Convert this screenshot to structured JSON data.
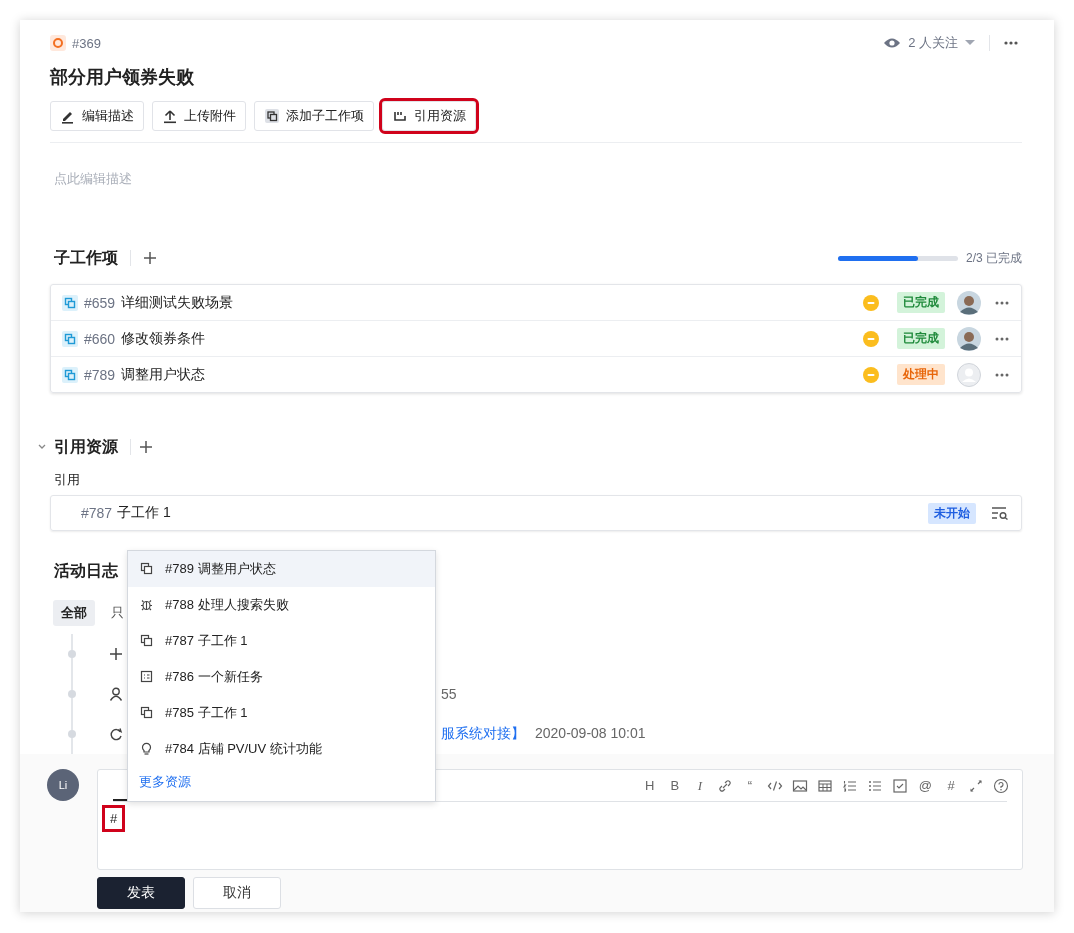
{
  "issue": {
    "kind": "bug",
    "number": "#369",
    "title": "部分用户领券失败"
  },
  "watchers": {
    "label": "2 人关注"
  },
  "actions": [
    {
      "kind": "edit",
      "label": "编辑描述",
      "highlighted": false
    },
    {
      "kind": "upload",
      "label": "上传附件",
      "highlighted": false
    },
    {
      "kind": "subtask",
      "label": "添加子工作项",
      "highlighted": false
    },
    {
      "kind": "quote",
      "label": "引用资源",
      "highlighted": true
    }
  ],
  "description": {
    "placeholder": "点此编辑描述"
  },
  "subtasks": {
    "title": "子工作项",
    "progress": {
      "level": 0.67,
      "label": "2/3 已完成"
    },
    "rows": [
      {
        "number": "#659",
        "title": "详细测试失败场景",
        "status": "已完成",
        "kind": "done",
        "assigned": true
      },
      {
        "number": "#660",
        "title": "修改领券条件",
        "status": "已完成",
        "kind": "done",
        "assigned": true
      },
      {
        "number": "#789",
        "title": "调整用户状态",
        "status": "处理中",
        "kind": "doing",
        "assigned": false
      }
    ]
  },
  "references": {
    "title": "引用资源",
    "expanded": true,
    "label": "引用",
    "items": [
      {
        "number": "#787",
        "title": "子工作 1",
        "status": "未开始",
        "kind": "todo"
      }
    ]
  },
  "activity": {
    "title": "活动日志",
    "tabs": [
      {
        "label": "全部",
        "selected": true
      },
      {
        "label": "只",
        "selected": false
      }
    ],
    "entries": [
      {
        "kind": "add"
      },
      {
        "kind": "user",
        "text": "55"
      },
      {
        "kind": "update",
        "link": "服系统对接】",
        "time": "2020-09-08 10:01"
      }
    ]
  },
  "mention_menu": {
    "items": [
      {
        "kind": "subtask",
        "number": "#789",
        "title": "调整用户状态",
        "selected": true
      },
      {
        "kind": "bug",
        "number": "#788",
        "title": "处理人搜索失败",
        "selected": false
      },
      {
        "kind": "subtask",
        "number": "#787",
        "title": "子工作 1",
        "selected": false
      },
      {
        "kind": "task",
        "number": "#786",
        "title": "一个新任务",
        "selected": false
      },
      {
        "kind": "subtask",
        "number": "#785",
        "title": "子工作 1",
        "selected": false
      },
      {
        "kind": "idea",
        "number": "#784",
        "title": "店铺 PV/UV 统计功能",
        "selected": false
      }
    ],
    "more": "更多资源"
  },
  "composer": {
    "avatar": "Li",
    "tabs": [
      {
        "selected": true
      }
    ],
    "toolbar": [
      {
        "kind": "glyph",
        "glyph": "H"
      },
      {
        "kind": "glyph",
        "glyph": "B"
      },
      {
        "kind": "italic",
        "glyph": "I"
      },
      {
        "kind": "link"
      },
      {
        "kind": "glyph",
        "glyph": "“"
      },
      {
        "kind": "code"
      },
      {
        "kind": "image"
      },
      {
        "kind": "table"
      },
      {
        "kind": "ordered-list"
      },
      {
        "kind": "bullet-list"
      },
      {
        "kind": "checkbox"
      },
      {
        "kind": "glyph",
        "glyph": "@"
      },
      {
        "kind": "glyph",
        "glyph": "#"
      },
      {
        "kind": "fullscreen"
      },
      {
        "kind": "help"
      }
    ],
    "text": "#",
    "highlighted": true,
    "buttons": [
      {
        "label": "发表",
        "kind": "primary"
      },
      {
        "label": "取消",
        "kind": "default"
      }
    ]
  }
}
